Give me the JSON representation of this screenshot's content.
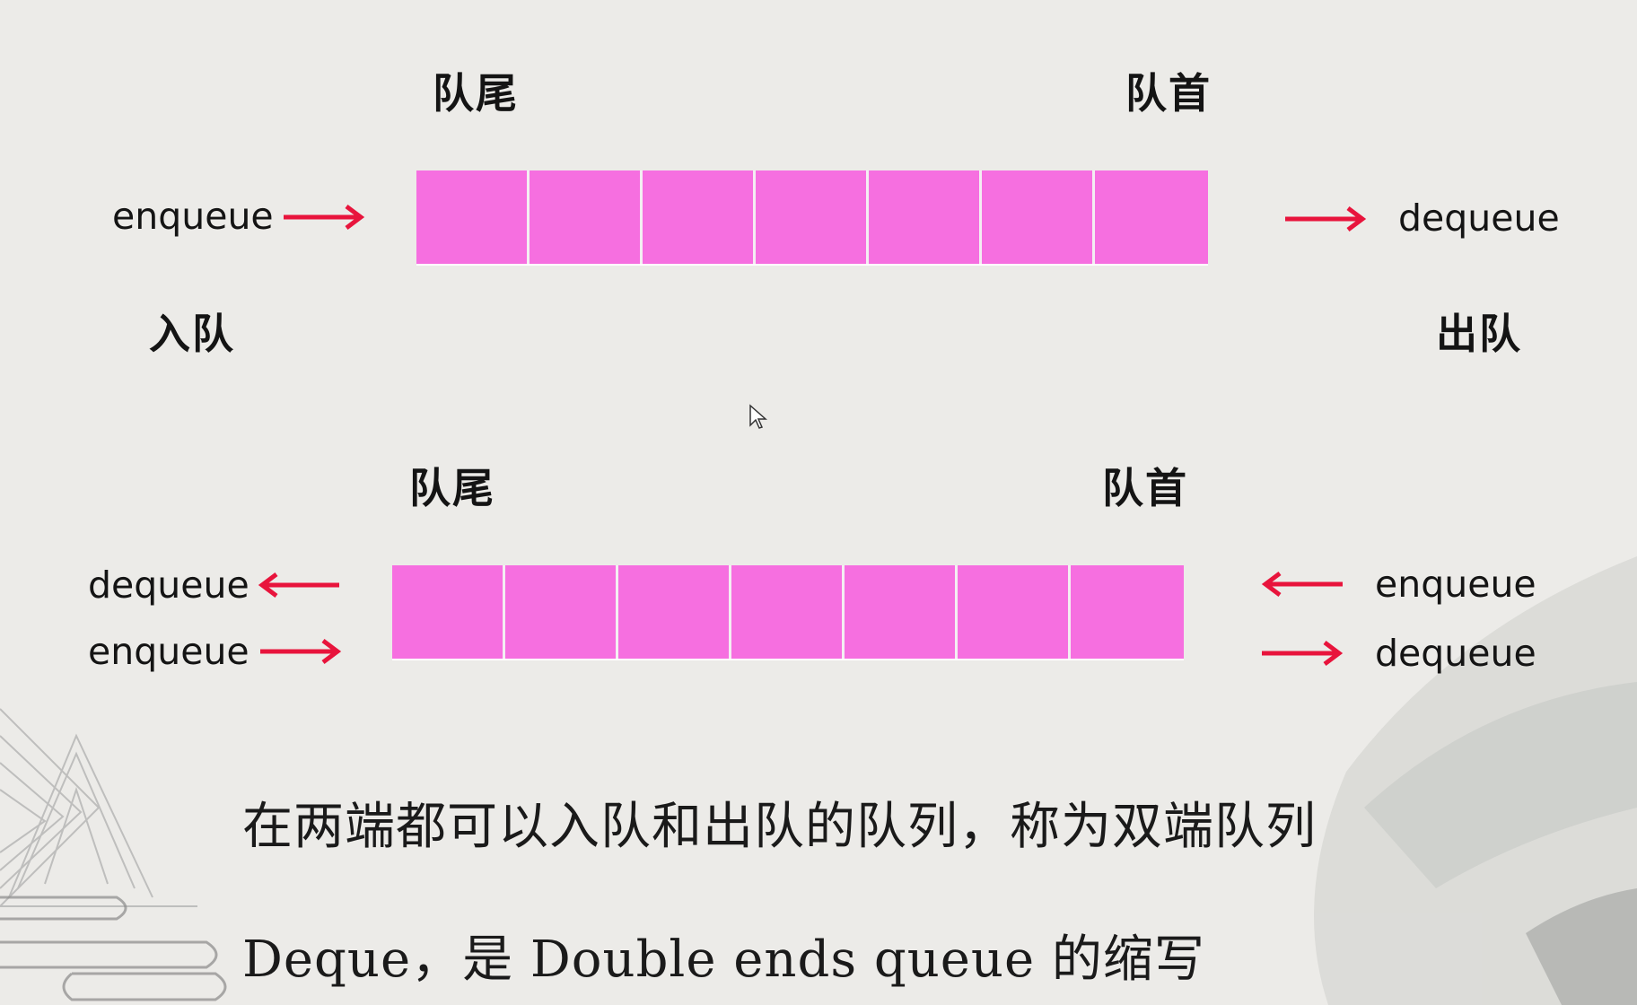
{
  "top_queue": {
    "tail_label": "队尾",
    "head_label": "队首",
    "left_op": "enqueue",
    "right_op": "dequeue",
    "left_caption": "入队",
    "right_caption": "出队",
    "cell_count": 7
  },
  "bottom_queue": {
    "tail_label": "队尾",
    "head_label": "队首",
    "left_ops": [
      "dequeue",
      "enqueue"
    ],
    "right_ops": [
      "enqueue",
      "dequeue"
    ],
    "cell_count": 7
  },
  "captions": {
    "definition": "在两端都可以入队和出队的队列，称为双端队列",
    "abbreviation": "Deque，是 Double ends queue 的缩写"
  },
  "colors": {
    "cell": "#f66fe0",
    "arrow": "#e8143c"
  },
  "icons": {
    "arrow": "arrow-icon",
    "cursor": "mouse-cursor-icon"
  }
}
